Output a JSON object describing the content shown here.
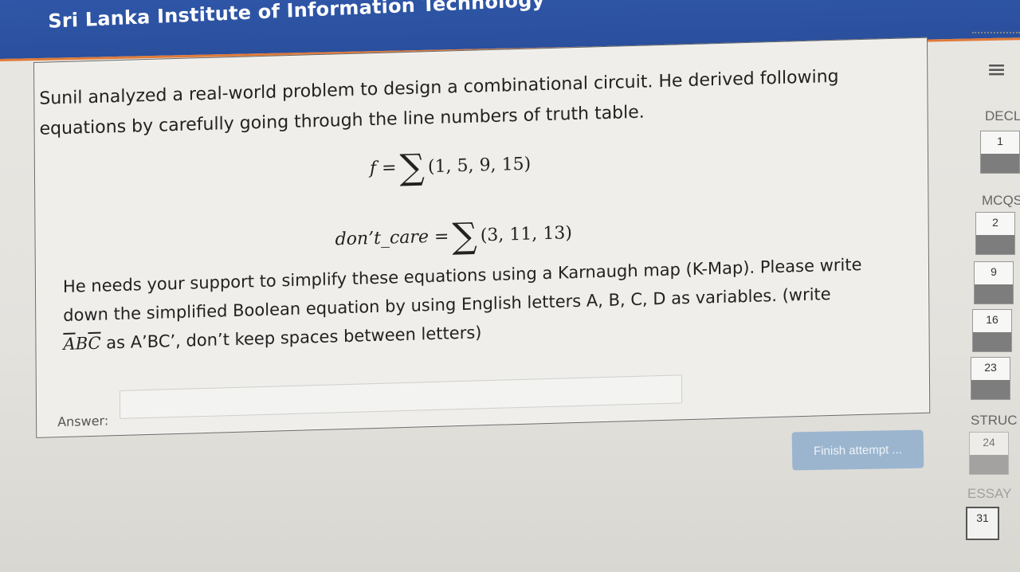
{
  "header": {
    "institution": "Sri Lanka Institute of Information Technology"
  },
  "question": {
    "line1": "Sunil analyzed a real-world problem to design a combinational circuit. He derived following",
    "line2": "equations by carefully going through the line numbers of truth table.",
    "eq1_lhs": "f =",
    "eq1_sigma": "∑",
    "eq1_terms": "(1, 5, 9, 15)",
    "eq2_lhs": "don’t_care =",
    "eq2_sigma": "∑",
    "eq2_terms": "(3, 11, 13)",
    "para_a": "He needs your support to simplify these equations using a Karnaugh map (K-Map). Please write",
    "para_b": "down the simplified Boolean equation by using English letters A, B, C, D as variables. (write",
    "example_a": "A",
    "example_b": "B",
    "example_c": "C",
    "para_c_rest": " as A’BC’, don’t keep spaces between letters)"
  },
  "answer": {
    "label": "Answer:",
    "value": ""
  },
  "finish_button": {
    "label": "Finish attempt ..."
  },
  "nav": {
    "menu_icon": "menu-icon",
    "menu_glyph": "≡",
    "sections": [
      {
        "label": "DECL",
        "items": [
          "1"
        ]
      },
      {
        "label": "MCQS",
        "items": [
          "2",
          "9",
          "16",
          "23"
        ]
      },
      {
        "label": "STRUC",
        "items": [
          "24"
        ]
      },
      {
        "label": "ESSAY",
        "items": [
          "31"
        ]
      }
    ]
  }
}
